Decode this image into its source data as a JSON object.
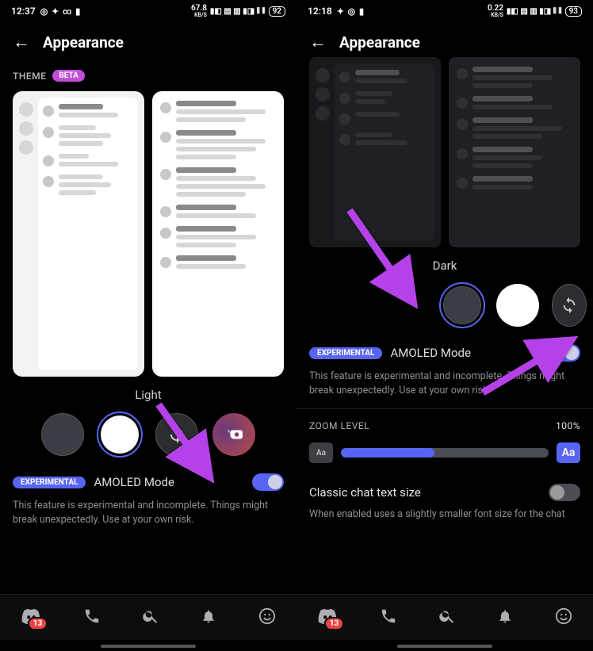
{
  "left": {
    "status": {
      "time": "12:37",
      "net": "67.8",
      "net_unit": "KB/S",
      "battery": "92"
    },
    "header": {
      "title": "Appearance"
    },
    "theme": {
      "label": "THEME",
      "beta": "BETA",
      "selected_name": "Light"
    },
    "amoled": {
      "pill": "EXPERIMENTAL",
      "label": "AMOLED Mode",
      "on": true,
      "desc": "This feature is experimental and incomplete. Things might break unexpectedly. Use at your own risk."
    },
    "nav": {
      "badge": "13"
    }
  },
  "right": {
    "status": {
      "time": "12:18",
      "net": "0.22",
      "net_unit": "KB/S",
      "battery": "93"
    },
    "header": {
      "title": "Appearance"
    },
    "theme": {
      "selected_name": "Dark"
    },
    "amoled": {
      "pill": "EXPERIMENTAL",
      "label": "AMOLED Mode",
      "on": true,
      "desc": "This feature is experimental and incomplete. Things might break unexpectedly. Use at your own risk."
    },
    "zoom": {
      "label": "ZOOM LEVEL",
      "value": "100%",
      "small": "Aa",
      "big": "Aa"
    },
    "classic": {
      "title": "Classic chat text size",
      "on": false,
      "desc": "When enabled uses a slightly smaller font size for the chat"
    },
    "nav": {
      "badge": "13"
    }
  }
}
